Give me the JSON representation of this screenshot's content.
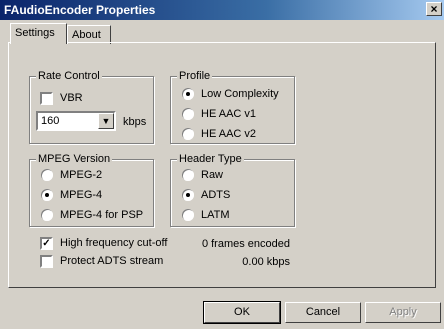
{
  "window": {
    "title": "FAudioEncoder Properties",
    "close_glyph": "×"
  },
  "tabs": [
    {
      "label": "Settings",
      "active": true
    },
    {
      "label": "About",
      "active": false
    }
  ],
  "rate_control": {
    "label": "Rate Control",
    "vbr": {
      "label": "VBR",
      "checked": false
    },
    "bitrate": {
      "value": "160",
      "unit": "kbps"
    }
  },
  "profile": {
    "label": "Profile",
    "options": [
      {
        "label": "Low Complexity",
        "selected": true
      },
      {
        "label": "HE AAC v1",
        "selected": false
      },
      {
        "label": "HE AAC v2",
        "selected": false
      }
    ]
  },
  "mpeg_version": {
    "label": "MPEG Version",
    "options": [
      {
        "label": "MPEG-2",
        "selected": false
      },
      {
        "label": "MPEG-4",
        "selected": true
      },
      {
        "label": "MPEG-4 for PSP",
        "selected": false
      }
    ]
  },
  "header_type": {
    "label": "Header Type",
    "options": [
      {
        "label": "Raw",
        "selected": false
      },
      {
        "label": "ADTS",
        "selected": true
      },
      {
        "label": "LATM",
        "selected": false
      }
    ]
  },
  "checks": [
    {
      "label": "High frequency cut-off",
      "checked": true
    },
    {
      "label": "Protect ADTS stream",
      "checked": false
    }
  ],
  "stats": {
    "frames": "0 frames encoded",
    "kbps": "0.00 kbps"
  },
  "buttons": {
    "ok": "OK",
    "cancel": "Cancel",
    "apply": "Apply"
  }
}
